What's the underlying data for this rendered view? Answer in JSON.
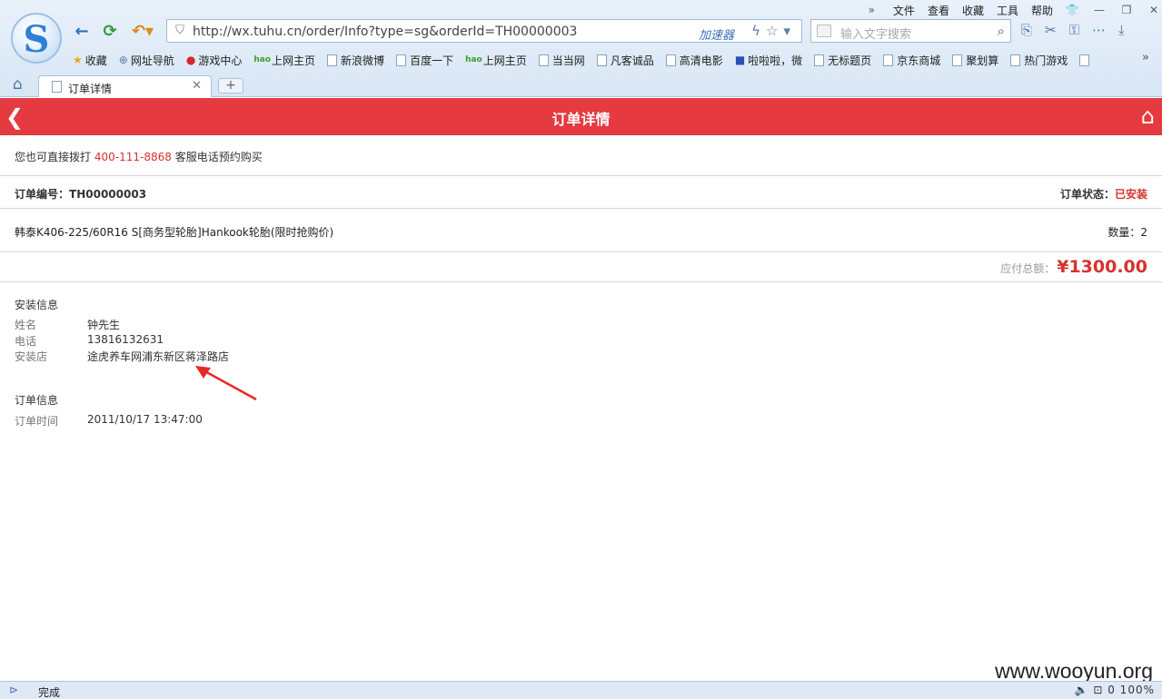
{
  "browser": {
    "menu": [
      "文件",
      "查看",
      "收藏",
      "工具",
      "帮助"
    ],
    "url": "http://wx.tuhu.cn/order/Info?type=sg&orderId=TH00000003",
    "accelerator": "加速器",
    "search_placeholder": "输入文字搜索",
    "bookmarks": [
      "收藏",
      "网址导航",
      "游戏中心",
      "上网主页",
      "新浪微博",
      "百度一下",
      "上网主页",
      "当当网",
      "凡客诚品",
      "高清电影",
      "啦啦啦，微",
      "无标题页",
      "京东商城",
      "聚划算",
      "热门游戏"
    ],
    "tab_title": "订单详情",
    "status_text": "完成",
    "status_right": "0   100%"
  },
  "header": {
    "title": "订单详情"
  },
  "call": {
    "prefix": "您也可直接拨打",
    "phone": "400-111-8868",
    "suffix": "客服电话预约购买"
  },
  "order": {
    "no_label": "订单编号：",
    "no": "TH00000003",
    "status_label": "订单状态：",
    "status": "已安装",
    "product": "韩泰K406-225/60R16 S[商务型轮胎]Hankook轮胎(限时抢购价)",
    "qty_label": "数量：",
    "qty": "2",
    "total_label": "应付总额：",
    "total": "¥1300.00"
  },
  "install": {
    "title": "安装信息",
    "name_label": "姓名",
    "name": "钟先生",
    "phone_label": "电话",
    "phone": "13816132631",
    "store_label": "安装店",
    "store": "途虎养车网浦东新区蒋泽路店"
  },
  "order_info": {
    "title": "订单信息",
    "time_label": "订单时间",
    "time": "2011/10/17 13:47:00"
  },
  "watermark": "www.wooyun.org",
  "colors": {
    "header_red": "#e53a40",
    "accent_red": "#d7322e"
  }
}
